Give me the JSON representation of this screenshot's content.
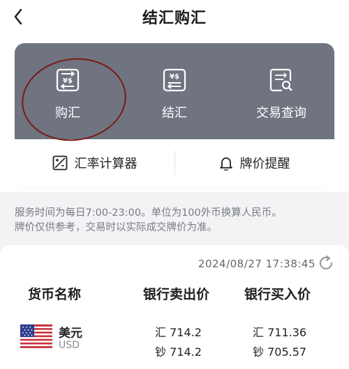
{
  "header": {
    "title": "结汇购汇"
  },
  "actions": [
    {
      "label": "购汇",
      "icon": "buy-fx-icon"
    },
    {
      "label": "结汇",
      "icon": "settle-fx-icon"
    },
    {
      "label": "交易查询",
      "icon": "transaction-search-icon"
    }
  ],
  "tools": [
    {
      "label": "汇率计算器",
      "icon": "calculator-icon"
    },
    {
      "label": "牌价提醒",
      "icon": "bell-icon"
    }
  ],
  "notice": {
    "line1": "服务时间为每日7:00-23:00。单位为100外币换算人民币。",
    "line2": "牌价仅供参考，交易时以实际成交牌价为准。"
  },
  "rates": {
    "timestamp": "2024/08/27 17:38:45",
    "columns": [
      "货币名称",
      "银行卖出价",
      "银行买入价"
    ],
    "rows": [
      {
        "name": "美元",
        "code": "USD",
        "sell": [
          "汇 714.2",
          "钞 714.2"
        ],
        "buy": [
          "汇 711.36",
          "钞 705.57"
        ]
      }
    ]
  },
  "colors": {
    "card_bg": "#6f7480",
    "annotation": "#7a1a14",
    "page_bg": "#f3f3f5"
  }
}
